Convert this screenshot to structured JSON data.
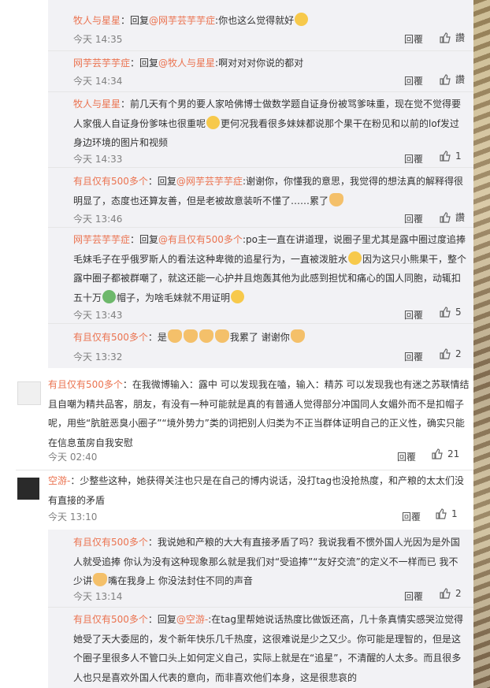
{
  "reply_group_1": [
    {
      "user": "牧人与星星",
      "body_parts": [
        "：回复",
        "@网芋芸芋芋症",
        ":你也这么觉得就好"
      ],
      "emoji": "face",
      "time": "今天 14:35",
      "reply_label": "回覆",
      "like_count": "",
      "like_alt": "讚"
    },
    {
      "user": "网芋芸芋芋症",
      "body_parts": [
        "：回复",
        "@牧人与星星",
        ":啊对对对你说的都对"
      ],
      "time": "今天 14:34",
      "reply_label": "回覆",
      "like_alt": "讚"
    },
    {
      "user": "牧人与星星",
      "lines": [
        "：前几天有个男的要人家哈佛博士做数学题自证身份被骂爹味重，现在觉不觉得要",
        "人家俄人自证身份爹味也很重呢",
        "更何况我看很多妹妹都说那个果干在粉见和以前的lof发过",
        "身边环境的图片和视频"
      ],
      "time": "今天 14:33",
      "reply_label": "回覆",
      "like_count": "1"
    },
    {
      "user": "有且仅有500多个",
      "lines": [
        "：回复",
        "@网芋芸芋芋症",
        ":谢谢你，你懂我的意思，我觉得的想法真的解释得很",
        "明显了，态度也还算友善，但是老被故意装听不懂了……累了"
      ],
      "time": "今天 13:46",
      "reply_label": "回覆",
      "like_alt": "讚"
    },
    {
      "user": "网芋芸芋芋症",
      "lines": [
        "：回复",
        "@有且仅有500多个",
        ":po主一直在讲道理，说圈子里尤其是露中圈过度追捧",
        "毛妹毛子在乎俄罗斯人的看法这种卑微的追星行为，一直被泼脏水",
        "因为这只小熊果干，",
        "整个露中圈子都被群嘲了，就这还能一心护井且炮轰其他为此感到担忧和痛心的国人同胞，动",
        "辄扣五十万",
        "帽子，为啥毛妹就不用证明"
      ],
      "time": "今天 13:43",
      "reply_label": "回覆",
      "like_count": "5"
    },
    {
      "user": "有且仅有500多个",
      "lines": [
        "：是",
        "我累了 谢谢你"
      ],
      "time": "今天 13:32",
      "reply_label": "回覆",
      "like_count": "2"
    }
  ],
  "comment_1": {
    "user": "有且仅有500多个",
    "lines": [
      "：在我微博输入：露中 可以发现我在嗑，输入：精苏 可以发现我也有迷之苏联情",
      "结且自嘲为精共品客，朋友，有没有一种可能就是真的有普通人觉得部分冲国同人女媚外而不是扣",
      "帽子呢，用些“肮脏恶臭小圈子”“境外势力”类的词把别人归类为不正当群体证明自己的正义性，确实",
      "只能在信息茧房自我安慰"
    ],
    "time": "今天 02:40",
    "reply_label": "回覆",
    "like_count": "21"
  },
  "comment_2": {
    "user": "空游-",
    "lines": [
      "：少整些这种，她获得关注也只是在自己的博内说话，没打tag也没抢热度，和产粮的太太们",
      "没有直接的矛盾"
    ],
    "time": "今天 13:10",
    "reply_label": "回覆",
    "like_count": "1"
  },
  "reply_group_2": [
    {
      "user": "有且仅有500多个",
      "lines": [
        "：我说她和产粮的大大有直接矛盾了吗？我说我看不惯外国人光因为是外国",
        "人就受追捧 你认为没有这种现象那么就是我们对“受追捧”“友好交流”的定义不一样而已 我不少",
        "讲",
        "嘴在我身上 你没法封住不同的声音"
      ],
      "time": "今天 13:14",
      "reply_label": "回覆",
      "like_count": "2"
    },
    {
      "user": "有且仅有500多个",
      "lines": [
        "：回复",
        "@空游-",
        ":在tag里帮她说话热度比做饭还高，几十条真情实感哭泣觉得",
        "她受了天大委屈的，发个新年快乐几千热度，这很难说是少之又少。你可能是理智的，但是这",
        "个圈子里很多人不管口头上如何定义自己，实际上就是在“追星”，不清醒的人太多。而且很多",
        "人也只是喜欢外国人代表的意向，而非喜欢他们本身，这是很悲哀的"
      ]
    }
  ],
  "colors": {
    "username": "#eb7350",
    "meta": "#808080",
    "reply_bg": "#f2f2f5"
  }
}
